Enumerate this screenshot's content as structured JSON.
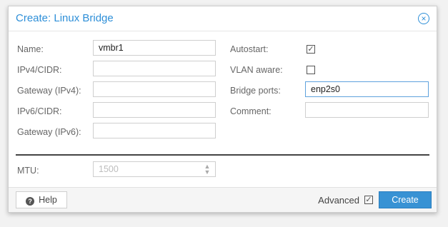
{
  "dialog": {
    "title": "Create: Linux Bridge",
    "close_glyph": "×"
  },
  "form": {
    "name_label": "Name:",
    "name_value": "vmbr1",
    "ipv4_label": "IPv4/CIDR:",
    "ipv4_value": "",
    "gw4_label": "Gateway (IPv4):",
    "gw4_value": "",
    "ipv6_label": "IPv6/CIDR:",
    "ipv6_value": "",
    "gw6_label": "Gateway (IPv6):",
    "gw6_value": "",
    "autostart_label": "Autostart:",
    "autostart_checked": true,
    "vlan_label": "VLAN aware:",
    "vlan_checked": false,
    "ports_label": "Bridge ports:",
    "ports_value": "enp2s0",
    "comment_label": "Comment:",
    "comment_value": "",
    "mtu_label": "MTU:",
    "mtu_placeholder": "1500"
  },
  "footer": {
    "help_label": "Help",
    "advanced_label": "Advanced",
    "advanced_checked": true,
    "create_label": "Create"
  },
  "icons": {
    "close": "close-icon",
    "help": "help-icon",
    "check": "checkmark-icon",
    "spinner": "spinner-arrows-icon"
  },
  "colors": {
    "accent": "#2e8fd8",
    "primary_button": "#3892d4"
  }
}
